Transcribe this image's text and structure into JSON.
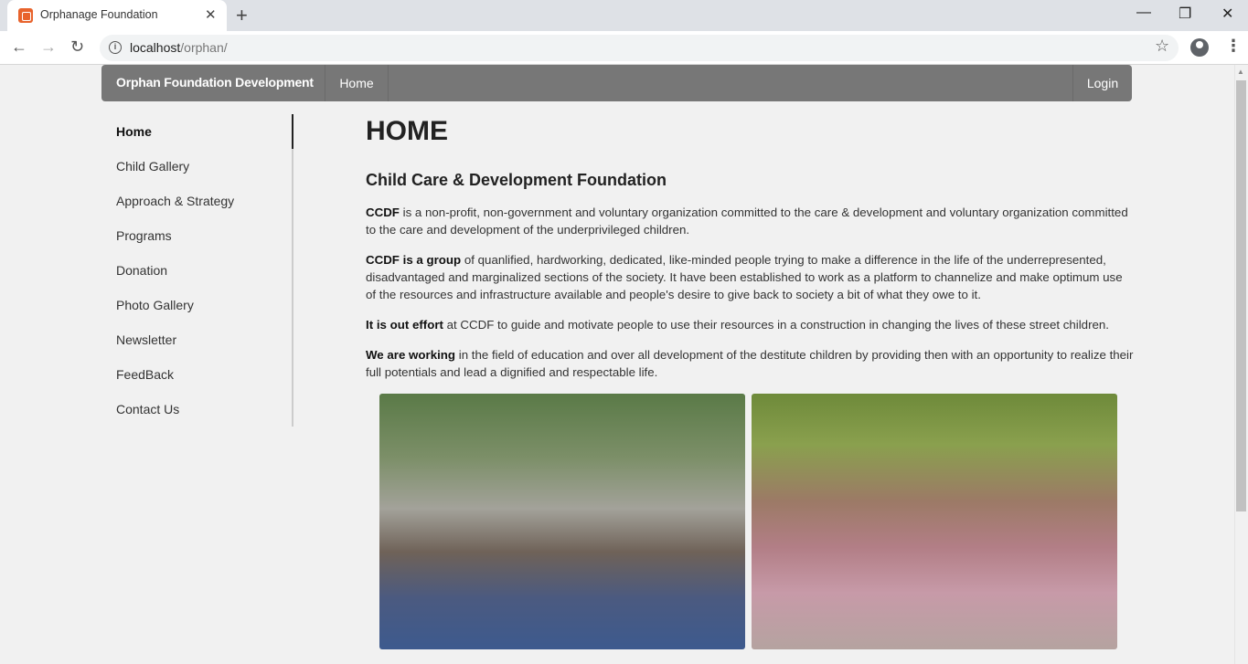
{
  "browser": {
    "tab_title": "Orphanage Foundation",
    "tab_close": "✕",
    "new_tab": "+",
    "url_host": "localhost",
    "url_path": "/orphan/",
    "window_controls": {
      "minimize": "—",
      "restore": "❐",
      "close": "✕"
    }
  },
  "navbar": {
    "brand": "Orphan Foundation Development",
    "home": "Home",
    "login": "Login"
  },
  "sidebar": {
    "items": [
      {
        "label": "Home",
        "active": true
      },
      {
        "label": "Child Gallery"
      },
      {
        "label": "Approach & Strategy"
      },
      {
        "label": "Programs"
      },
      {
        "label": "Donation"
      },
      {
        "label": "Photo Gallery"
      },
      {
        "label": "Newsletter"
      },
      {
        "label": "FeedBack"
      },
      {
        "label": "Contact Us"
      }
    ]
  },
  "main": {
    "title": "HOME",
    "subheading": "Child Care & Development Foundation",
    "paragraphs": [
      {
        "lead": "CCDF",
        "text": " is a non-profit, non-government and voluntary organization committed to the care & development and voluntary organization committed to the care and development of the underprivileged children."
      },
      {
        "lead": "CCDF is a group",
        "text": " of quanlified, hardworking, dedicated, like-minded people trying to make a difference in the life of the underrepresented, disadvantaged and marginalized sections of the society. It have been established to work as a platform to channelize and make optimum use of the resources and infrastructure available and people's desire to give back to society a bit of what they owe to it."
      },
      {
        "lead": "It is out effort",
        "text": " at CCDF to guide and motivate people to use their resources in a construction in changing the lives of these street children."
      },
      {
        "lead": "We are working",
        "text": " in the field of education and over all development of the destitute children by providing then with an opportunity to realize their full potentials and lead a dignified and respectable life."
      }
    ]
  },
  "colors": {
    "navbar_bg": "#777777",
    "page_bg": "#f1f1f1",
    "favicon": "#e8632c"
  }
}
